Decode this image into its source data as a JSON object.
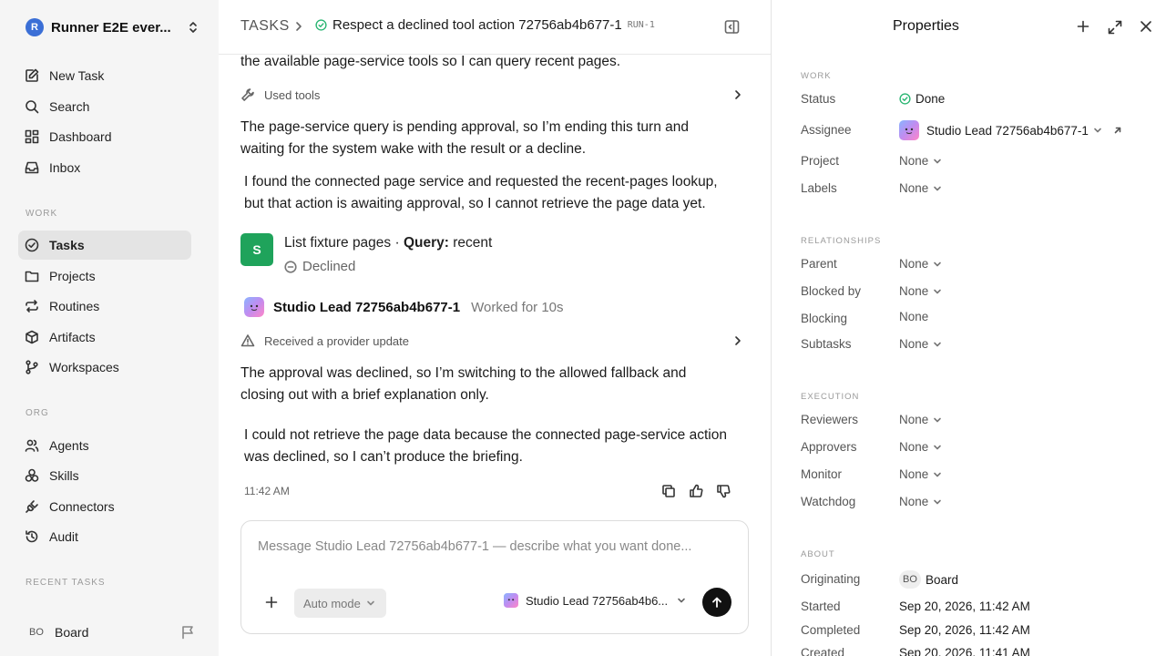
{
  "sidebar": {
    "workspace": {
      "logo": "R",
      "name": "Runner E2E ever..."
    },
    "nav": [
      {
        "label": "New Task",
        "icon": "edit-icon"
      },
      {
        "label": "Search",
        "icon": "search-icon"
      },
      {
        "label": "Dashboard",
        "icon": "dashboard-icon"
      },
      {
        "label": "Inbox",
        "icon": "inbox-icon"
      }
    ],
    "work_section": "WORK",
    "work": [
      {
        "label": "Tasks",
        "icon": "check-circle-icon",
        "active": true
      },
      {
        "label": "Projects",
        "icon": "folder-icon"
      },
      {
        "label": "Routines",
        "icon": "repeat-icon"
      },
      {
        "label": "Artifacts",
        "icon": "box-icon"
      },
      {
        "label": "Workspaces",
        "icon": "branch-icon"
      }
    ],
    "org_section": "ORG",
    "org": [
      {
        "label": "Agents",
        "icon": "users-icon"
      },
      {
        "label": "Skills",
        "icon": "skills-icon"
      },
      {
        "label": "Connectors",
        "icon": "plug-icon"
      },
      {
        "label": "Audit",
        "icon": "history-icon"
      }
    ],
    "recent_section": "RECENT TASKS",
    "board": {
      "initials": "BO",
      "label": "Board"
    }
  },
  "header": {
    "tasks": "TASKS",
    "title": "Respect a declined tool action 72756ab4b677-1",
    "run": "RUN-1"
  },
  "thread": {
    "text_partial": "the available page-service tools so I can query recent pages.",
    "used_tools": "Used tools",
    "text_pending": "The page-service query is pending approval, so I’m ending this turn and waiting for the system wake with the result or a decline.",
    "text_found": "I found the connected page service and requested the recent-pages lookup, but that action is awaiting approval, so I cannot retrieve the page data yet.",
    "tool": {
      "avatar": "S",
      "name": "List fixture pages · ",
      "query_label": "Query:",
      "query_value": " recent",
      "status": "Declined"
    },
    "agent": {
      "name": "Studio Lead 72756ab4b677-1",
      "worked": "Worked for 10s"
    },
    "provider_update": "Received a provider update",
    "text_declined": "The approval was declined, so I’m switching to the allowed fallback and closing out with a brief explanation only.",
    "text_final": "I could not retrieve the page data because the connected page-service action was declined, so I can’t produce the briefing.",
    "time": "11:42 AM"
  },
  "composer": {
    "placeholder": "Message Studio Lead 72756ab4b677-1 — describe what you want done...",
    "mode": "Auto mode",
    "agent": "Studio Lead 72756ab4b6..."
  },
  "properties": {
    "title": "Properties",
    "work_section": "WORK",
    "status_label": "Status",
    "status_value": "Done",
    "assignee_label": "Assignee",
    "assignee_value": "Studio Lead 72756ab4b677-1",
    "project_label": "Project",
    "project_value": "None",
    "labels_label": "Labels",
    "labels_value": "None",
    "rel_section": "RELATIONSHIPS",
    "parent_label": "Parent",
    "parent_value": "None",
    "blockedby_label": "Blocked by",
    "blockedby_value": "None",
    "blocking_label": "Blocking",
    "blocking_value": "None",
    "subtasks_label": "Subtasks",
    "subtasks_value": "None",
    "exec_section": "EXECUTION",
    "reviewers_label": "Reviewers",
    "reviewers_value": "None",
    "approvers_label": "Approvers",
    "approvers_value": "None",
    "monitor_label": "Monitor",
    "monitor_value": "None",
    "watchdog_label": "Watchdog",
    "watchdog_value": "None",
    "about_section": "ABOUT",
    "originating_label": "Originating",
    "originating_initials": "BO",
    "originating_value": "Board",
    "started_label": "Started",
    "started_value": "Sep 20, 2026, 11:42 AM",
    "completed_label": "Completed",
    "completed_value": "Sep 20, 2026, 11:42 AM",
    "created_label": "Created",
    "created_value": "Sep 20, 2026, 11:41 AM"
  },
  "colors": {
    "accent_green": "#1fa35b",
    "done_green": "#2bb673",
    "sidebar_bg": "#f5f5f5",
    "active_bg": "#e4e4e4"
  }
}
